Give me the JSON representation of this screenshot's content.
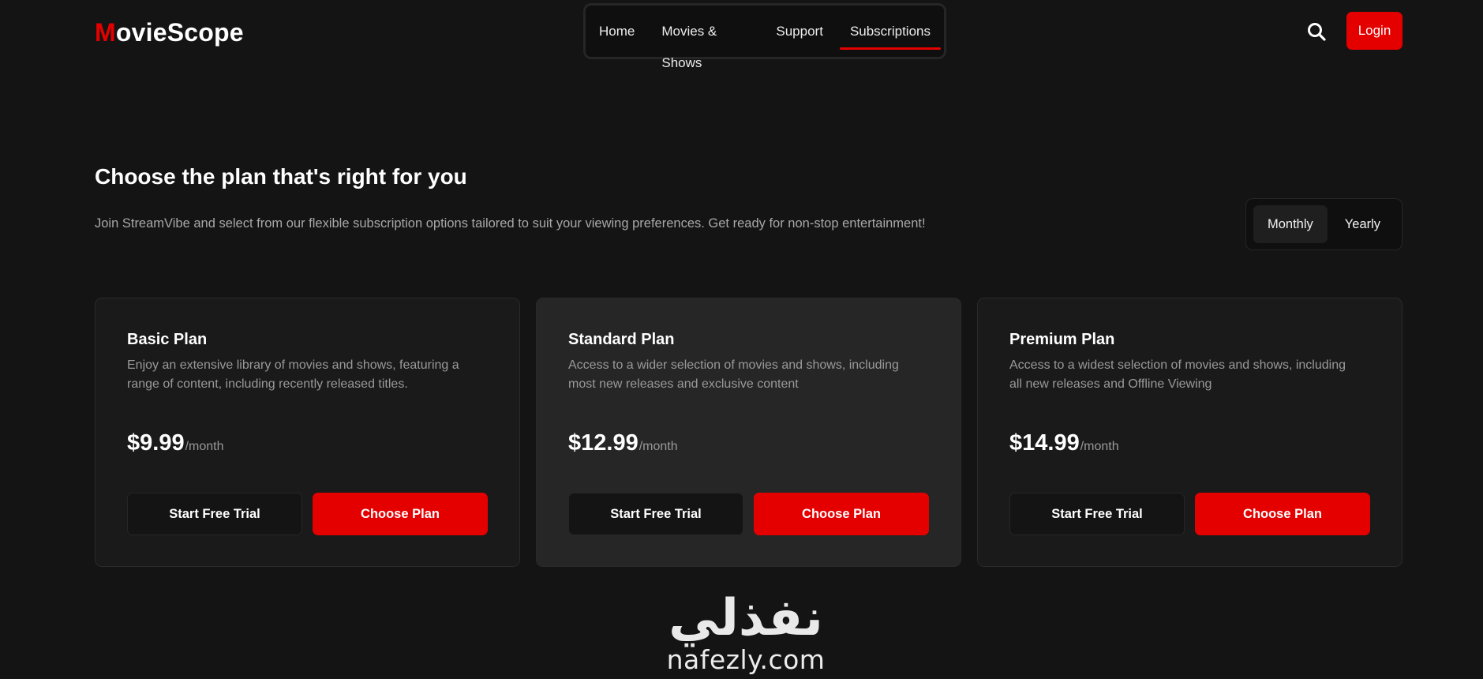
{
  "header": {
    "logo_first": "M",
    "logo_rest": "ovieScope",
    "nav": [
      {
        "label": "Home"
      },
      {
        "label": "Movies & Shows"
      },
      {
        "label": "Support"
      },
      {
        "label": "Subscriptions"
      }
    ],
    "active_nav": "Subscriptions",
    "search_icon": "search-icon",
    "login_label": "Login"
  },
  "hero": {
    "title": "Choose the plan that's right for you",
    "subtitle": "Join StreamVibe and select from our flexible subscription options tailored to suit your viewing preferences. Get ready for non-stop entertainment!",
    "billing_options": [
      "Monthly",
      "Yearly"
    ],
    "selected_billing": "Monthly"
  },
  "plans": [
    {
      "name": "Basic Plan",
      "description": "Enjoy an extensive library of movies and shows, featuring a range of content, including recently released titles.",
      "price": "$9.99",
      "period": "/month",
      "trial_label": "Start Free Trial",
      "choose_label": "Choose Plan"
    },
    {
      "name": "Standard Plan",
      "description": "Access to a wider selection of movies and shows, including most new releases and exclusive content",
      "price": "$12.99",
      "period": "/month",
      "trial_label": "Start Free Trial",
      "choose_label": "Choose Plan"
    },
    {
      "name": "Premium Plan",
      "description": "Access to a widest selection of movies and shows, including all new releases and Offline Viewing",
      "price": "$14.99",
      "period": "/month",
      "trial_label": "Start Free Trial",
      "choose_label": "Choose Plan"
    }
  ],
  "watermark": {
    "arabic": "نفذلي",
    "latin": "nafezly.com"
  },
  "colors": {
    "accent": "#e50000",
    "background": "#141414",
    "card": "#1a1a1a",
    "card_featured": "#262626"
  }
}
